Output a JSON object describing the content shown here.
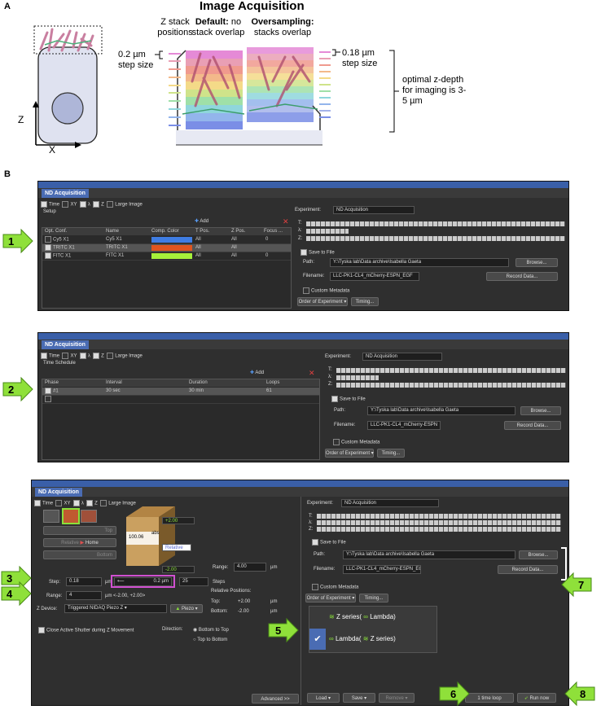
{
  "figure": {
    "panel_a": "A",
    "panel_b": "B",
    "title": "Image Acquisition",
    "axis_z": "Z",
    "axis_x": "X",
    "z_stack_positions": "Z stack positions",
    "default_bold": "Default:",
    "default_rest": "no stack overlap",
    "oversampling_bold": "Oversampling:",
    "oversampling_rest": "stacks overlap",
    "left_step": "0.2 µm step size",
    "right_step": "0.18 µm step size",
    "optimal": "optimal z-depth for imaging is 3-5 µm"
  },
  "window": {
    "tab": "ND Acquisition",
    "tabs": [
      "Time",
      "XY",
      "λ",
      "Z",
      "Large Image"
    ],
    "add": "Add",
    "experiment_label": "Experiment:",
    "experiment_value": "ND Acquisition",
    "t_label": "T:",
    "l_label": "λ:",
    "z_label": "Z:",
    "save_to_file": "Save to File",
    "path_label": "Path:",
    "path_value": "Y:\\Tyska lab\\Data archive\\Isabella Gaeta",
    "browse": "Browse...",
    "filename_label": "Filename:",
    "filename_1": "LLC-PK1-CL4_mCherry-ESPN_EGF",
    "filename_2": "LLC-PK1-CL4_mCherry-ESPN",
    "filename_3": "LLC-PK1-CL4_mCherry-ESPN_EG",
    "record_data": "Record Data...",
    "custom_metadata": "Custom Metadata",
    "order_of_experiment": "Order of Experiment",
    "timing": "Timing..."
  },
  "panel1": {
    "section": "Setup",
    "headers": [
      "Opt. Conf.",
      "Name",
      "Comp. Color",
      "T Pos.",
      "Z Pos.",
      "Focus ..."
    ],
    "rows": [
      {
        "conf": "Cy5 X1",
        "name": "Cy5 X1",
        "color": "#3f7de3",
        "t": "All",
        "z": "All",
        "focus": "0"
      },
      {
        "conf": "TRITC X1",
        "name": "TRITC X1",
        "color": "#e0551f",
        "t": "All",
        "z": "All",
        "focus": ""
      },
      {
        "conf": "FITC X1",
        "name": "FITC X1",
        "color": "#a6f03a",
        "t": "All",
        "z": "All",
        "focus": "0"
      }
    ]
  },
  "panel2": {
    "section": "Time Schedule",
    "headers": [
      "Phase",
      "Interval",
      "Duration",
      "Loops"
    ],
    "row": {
      "phase": "#1",
      "interval": "30 sec",
      "duration": "30 min",
      "loops": "61"
    }
  },
  "panel3": {
    "top": "Top",
    "relative": "Relative",
    "home": "Home",
    "bottom": "Bottom",
    "cube_top": "+2.00",
    "cube_abs": "abs",
    "cube_val": "100.06",
    "cube_relative": "Relative",
    "cube_bottom": "-2.00",
    "step_label": "Step:",
    "step_value": "0.18",
    "unit": "µm",
    "step_um": "0.2 µm",
    "steps_value": "25",
    "steps_label": "Steps",
    "range_label": "Range:",
    "range_value": "4",
    "range_hint": "<-2.00, +2.00>",
    "range_right_label": "Range:",
    "range_right_value": "4.00",
    "relative_positions": "Relative Positions:",
    "top_label": "Top:",
    "top_value": "+2.00",
    "bottom_label": "Bottom:",
    "bottom_value": "-2.00",
    "zdevice_label": "Z Device:",
    "zdevice_value": "Triggered NIDAQ Piezo Z",
    "piezo": "Piezo",
    "close_shutter": "Close Active Shutter during Z Movement",
    "direction": "Direction:",
    "bottom_to_top": "Bottom to Top",
    "top_to_bottom": "Top to Bottom",
    "order1_a": "Z series(",
    "order1_b": "Lambda)",
    "order2_a": "Lambda(",
    "order2_b": "Z series)",
    "advanced": "Advanced >>",
    "load": "Load",
    "save": "Save",
    "remove": "Remove",
    "time_loop": "1 time loop",
    "run_now": "Run now"
  },
  "callouts": [
    "1",
    "2",
    "3",
    "4",
    "5",
    "6",
    "7",
    "8"
  ],
  "colors": {
    "arrow_fill": "#8fe03a",
    "arrow_stroke": "#4a8a18",
    "magenta": "#d050d0"
  }
}
